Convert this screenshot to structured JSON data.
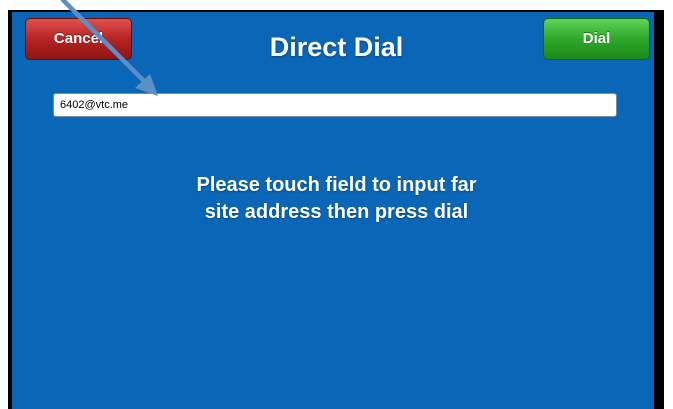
{
  "header": {
    "title": "Direct Dial",
    "cancel_label": "Cancel",
    "dial_label": "Dial"
  },
  "address_field": {
    "value": "6402@vtc.me"
  },
  "instructions": {
    "line1": "Please touch field to input far",
    "line2": "site address then press dial"
  },
  "colors": {
    "screen_background": "#0a67b8",
    "cancel_button": "#b52422",
    "dial_button": "#2ea82a",
    "annotation_arrow": "#5b8fc7"
  }
}
